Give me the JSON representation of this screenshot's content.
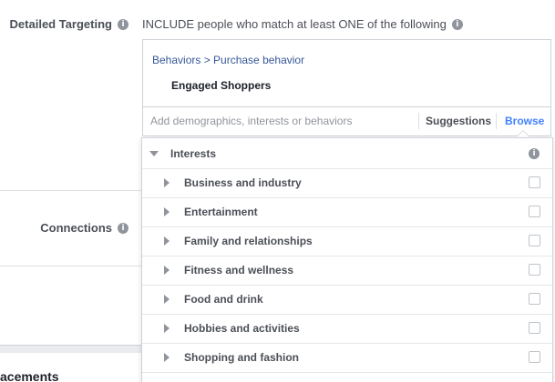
{
  "labels": {
    "detailed_targeting": "Detailed Targeting",
    "connections": "Connections",
    "placements_partial": "acements"
  },
  "include_text": "INCLUDE people who match at least ONE of the following",
  "targeting": {
    "breadcrumb": "Behaviors > Purchase behavior",
    "selected_item": "Engaged Shoppers"
  },
  "search": {
    "placeholder": "Add demographics, interests or behaviors",
    "value": "",
    "suggestions_label": "Suggestions",
    "browse_label": "Browse"
  },
  "browse_panel": {
    "header": "Interests",
    "categories": [
      {
        "label": "Business and industry",
        "checked": false
      },
      {
        "label": "Entertainment",
        "checked": false
      },
      {
        "label": "Family and relationships",
        "checked": false
      },
      {
        "label": "Fitness and wellness",
        "checked": false
      },
      {
        "label": "Food and drink",
        "checked": false
      },
      {
        "label": "Hobbies and activities",
        "checked": false
      },
      {
        "label": "Shopping and fashion",
        "checked": false
      }
    ]
  },
  "colors": {
    "link": "#365899",
    "active_tab": "#4080ff",
    "text": "#4b4f56",
    "border": "#cfd2d7"
  },
  "icons": {
    "info": "info-icon",
    "expand": "caret-right-icon",
    "collapse": "caret-down-icon"
  }
}
